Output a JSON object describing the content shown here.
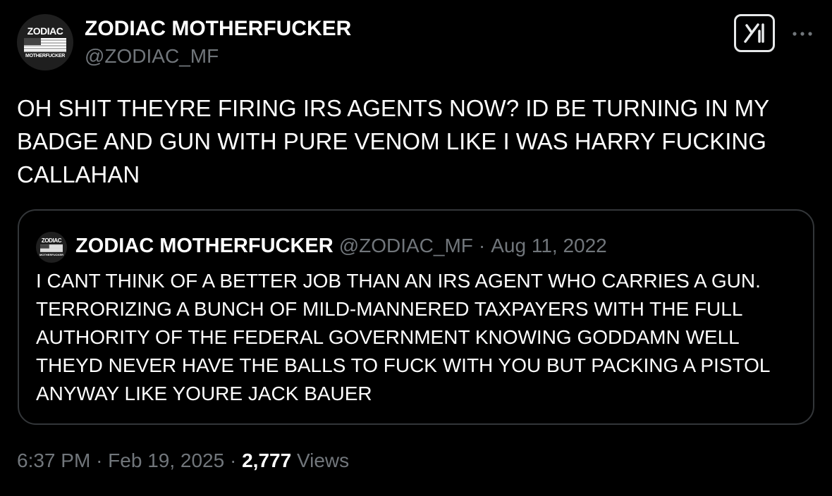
{
  "author": {
    "name": "ZODIAC MOTHERFUCKER",
    "handle": "@ZODIAC_MF",
    "avatar_text_top": "ZODIAC",
    "avatar_text_bottom": "MOTHERFUCKER"
  },
  "tweet": {
    "text": "OH SHIT THEYRE FIRING IRS AGENTS NOW? ID BE TURNING IN MY BADGE AND GUN WITH PURE VENOM LIKE I WAS HARRY FUCKING CALLAHAN"
  },
  "quoted_tweet": {
    "name": "ZODIAC MOTHERFUCKER",
    "handle": "@ZODIAC_MF",
    "separator": "·",
    "date": "Aug 11, 2022",
    "avatar_text_top": "ZODIAC",
    "avatar_text_bottom": "MOTHERFUCKER",
    "text": "I CANT THINK OF A BETTER JOB THAN AN IRS AGENT WHO CARRIES A GUN. TERRORIZING A BUNCH OF MILD-MANNERED TAXPAYERS WITH THE FULL AUTHORITY OF THE FEDERAL GOVERNMENT KNOWING GODDAMN WELL THEYD NEVER HAVE THE BALLS TO FUCK WITH YOU BUT PACKING A PISTOL ANYWAY LIKE YOURE JACK BAUER"
  },
  "footer": {
    "time": "6:37 PM",
    "separator": "·",
    "date": "Feb 19, 2025",
    "views_count": "2,777",
    "views_label": "Views"
  },
  "icons": {
    "grok": "grok-icon",
    "more": "more-icon"
  },
  "colors": {
    "background": "#000000",
    "text": "#e7e9ea",
    "secondary": "#71767b",
    "border": "#333639"
  }
}
